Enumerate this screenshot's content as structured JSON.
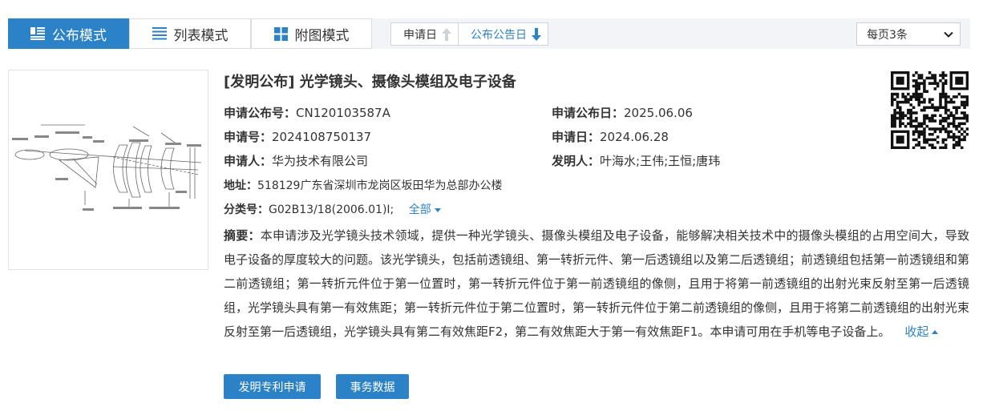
{
  "view_modes": [
    {
      "label": "公布模式",
      "active": true
    },
    {
      "label": "列表模式",
      "active": false
    },
    {
      "label": "附图模式",
      "active": false
    }
  ],
  "sort": {
    "by_application_date": {
      "label": "申请日",
      "direction": "up",
      "active": false
    },
    "by_publication_date": {
      "label": "公布公告日",
      "direction": "down",
      "active": true
    }
  },
  "per_page": {
    "selected": "每页3条"
  },
  "result": {
    "title": "[发明公布] 光学镜头、摄像头模组及电子设备",
    "pub_no": {
      "label": "申请公布号：",
      "value": "CN120103587A"
    },
    "pub_date": {
      "label": "申请公布日：",
      "value": "2025.06.06"
    },
    "app_no": {
      "label": "申请号：",
      "value": "2024108750137"
    },
    "app_date": {
      "label": "申请日：",
      "value": "2024.06.28"
    },
    "applicant": {
      "label": "申请人：",
      "value": "华为技术有限公司"
    },
    "inventor": {
      "label": "发明人：",
      "value": "叶海水;王伟;王恒;唐玮"
    },
    "address": {
      "label": "地址：",
      "value": "518129广东省深圳市龙岗区坂田华为总部办公楼"
    },
    "classification": {
      "label": "分类号：",
      "value": "G02B13/18(2006.01)I;",
      "expand_label": "全部"
    },
    "abstract": {
      "label": "摘要：",
      "text": "本申请涉及光学镜头技术领域，提供一种光学镜头、摄像头模组及电子设备，能够解决相关技术中的摄像头模组的占用空间大，导致电子设备的厚度较大的问题。该光学镜头，包括前透镜组、第一转折元件、第一后透镜组以及第二后透镜组；前透镜组包括第一前透镜组和第二前透镜组；第一转折元件位于第一位置时，第一转折元件位于第一前透镜组的像侧，且用于将第一前透镜组的出射光束反射至第一后透镜组，光学镜头具有第一有效焦距；第一转折元件位于第二位置时，第一转折元件位于第二前透镜组的像侧，且用于将第二前透镜组的出射光束反射至第一后透镜组，光学镜头具有第二有效焦距F2，第二有效焦距大于第一有效焦距F1。本申请可用在手机等电子设备上。",
      "collapse_label": "收起"
    },
    "buttons": {
      "patent_application": "发明专利申请",
      "affairs_data": "事务数据"
    }
  },
  "colors": {
    "accent": "#2c82c6",
    "toolbar_bg": "#f3f4f7"
  },
  "icons": {
    "public_mode": "article-icon",
    "list_mode": "list-icon",
    "drawing_mode": "grid-icon",
    "sort_up": "arrow-up-icon",
    "sort_down": "arrow-down-icon",
    "qr": "qr-code-icon"
  }
}
